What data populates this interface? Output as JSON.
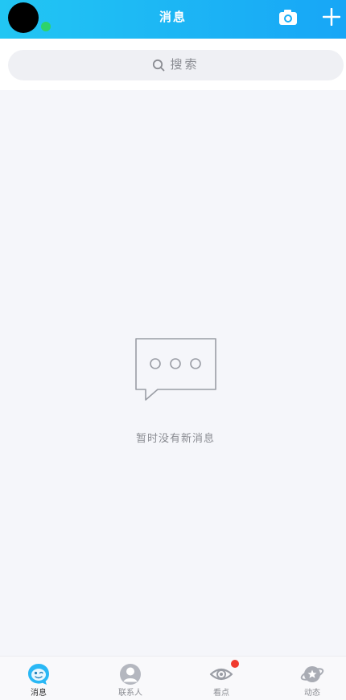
{
  "header": {
    "title": "消息"
  },
  "search": {
    "label": "搜索"
  },
  "empty_state": {
    "message": "暂时没有新消息"
  },
  "tabs": [
    {
      "label": "消息",
      "icon": "message-icon",
      "active": true
    },
    {
      "label": "联系人",
      "icon": "contacts-icon",
      "active": false
    },
    {
      "label": "看点",
      "icon": "eye-icon",
      "active": false,
      "badge": true
    },
    {
      "label": "动态",
      "icon": "planet-star-icon",
      "active": false
    }
  ],
  "icons": {
    "camera": "camera-icon",
    "add": "plus-icon",
    "search": "search-icon",
    "empty": "chat-bubble-icon"
  },
  "colors": {
    "header_gradient_start": "#22c6f3",
    "header_gradient_end": "#17a6f6",
    "status_dot": "#2ed36a",
    "badge": "#f03a2e",
    "active_tab": "#2ab8f5",
    "page_background": "#f5f6fa"
  }
}
